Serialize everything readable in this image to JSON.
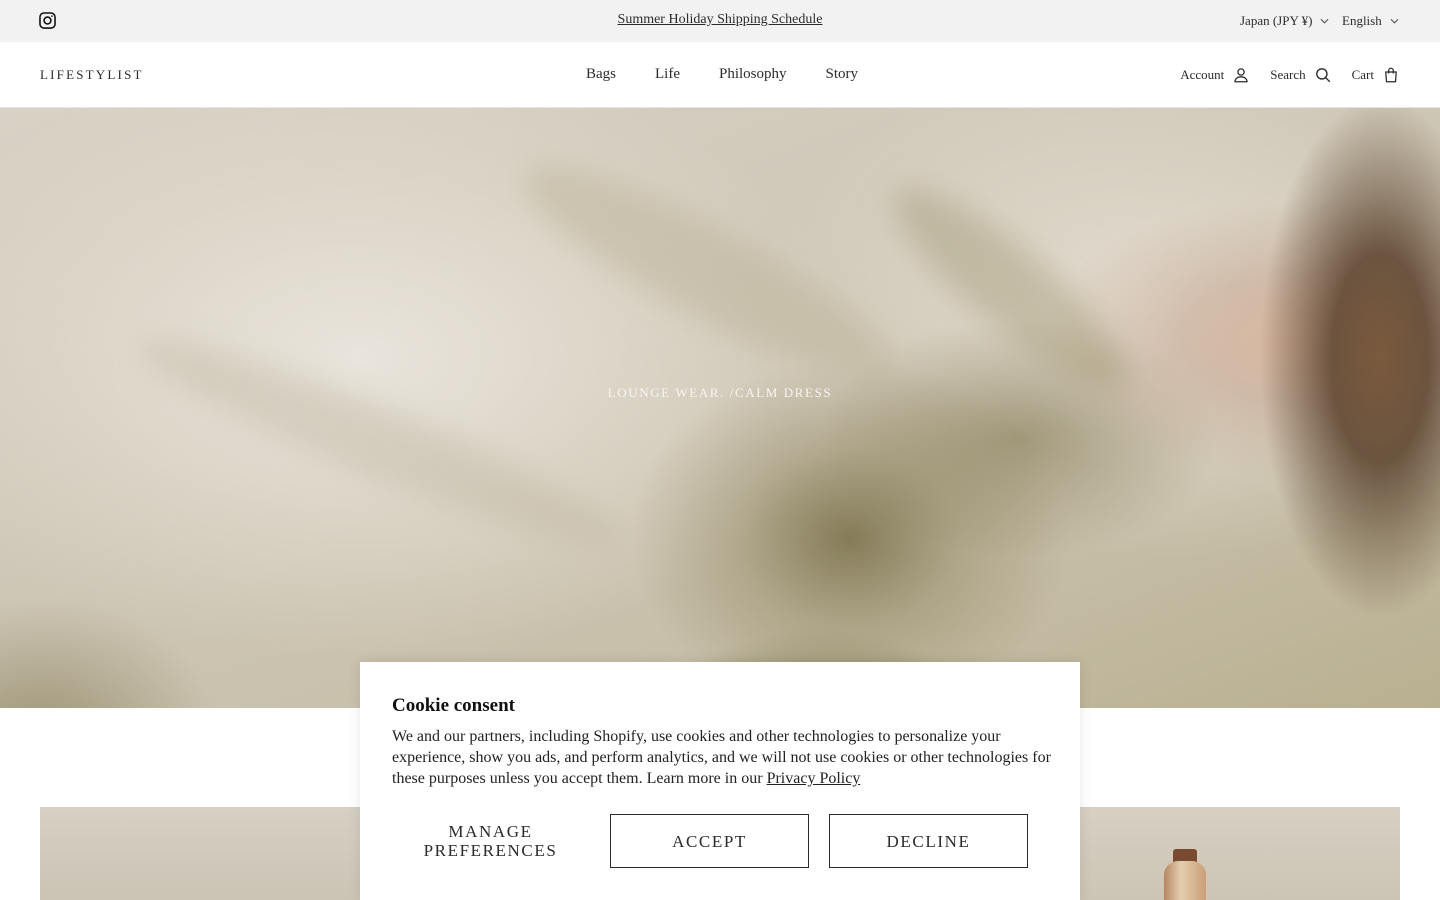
{
  "announcement": {
    "text": "Summer Holiday Shipping Schedule",
    "country": "Japan (JPY ¥)",
    "language": "English"
  },
  "header": {
    "logo": "LIFESTYLIST",
    "nav": [
      "Bags",
      "Life",
      "Philosophy",
      "Story"
    ],
    "account_label": "Account",
    "search_label": "Search",
    "cart_label": "Cart"
  },
  "hero": {
    "caption": "LOUNGE WEAR. /CALM DRESS"
  },
  "cookie": {
    "title": "Cookie consent",
    "body": "We and our partners, including Shopify, use cookies and other technologies to personalize your experience, show you ads, and perform analytics, and we will not use cookies or other technologies for these purposes unless you accept them. Learn more in our ",
    "privacy_link": "Privacy Policy",
    "manage_label": "MANAGE PREFERENCES",
    "accept_label": "ACCEPT",
    "decline_label": "DECLINE"
  },
  "icons": {
    "social": "instagram-icon",
    "account": "user-icon",
    "search": "search-icon",
    "cart": "bag-icon",
    "dropdown": "chevron-down-icon"
  },
  "colors": {
    "topbar_bg": "#f2f2f2",
    "text": "#2b2b2b",
    "dialog_bg": "#ffffff"
  }
}
